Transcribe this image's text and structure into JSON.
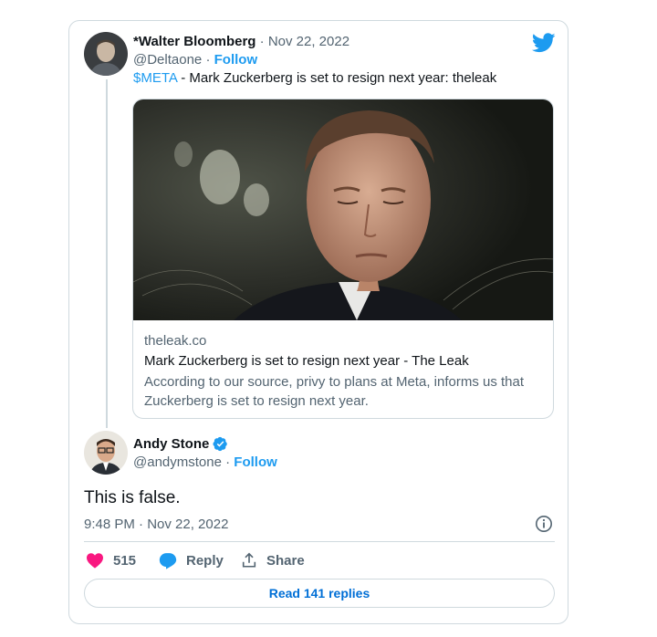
{
  "quoted_tweet": {
    "author_name": "*Walter Bloomberg",
    "separator": "·",
    "date": "Nov 22, 2022",
    "handle": "@Deltaone",
    "follow_label": "Follow",
    "cashtag": "$META",
    "text": " - Mark Zuckerberg is set to resign next year: theleak",
    "link_card": {
      "domain": "theleak.co",
      "title": "Mark Zuckerberg is set to resign next year - The Leak",
      "description_line1": "According to our source, privy to plans at Meta, informs us that",
      "description_line2": "Zuckerberg is set to resign next year."
    }
  },
  "reply_tweet": {
    "author_name": "Andy Stone",
    "verified": true,
    "handle": "@andymstone",
    "separator": "·",
    "follow_label": "Follow",
    "text": "This is false.",
    "timestamp": "9:48 PM · Nov 22, 2022"
  },
  "actions": {
    "like_count": "515",
    "reply_label": "Reply",
    "share_label": "Share"
  },
  "read_replies_label": "Read 141 replies",
  "colors": {
    "accent": "#1d9bf0",
    "like": "#f91880",
    "muted": "#536471",
    "border": "#cfd9de"
  }
}
